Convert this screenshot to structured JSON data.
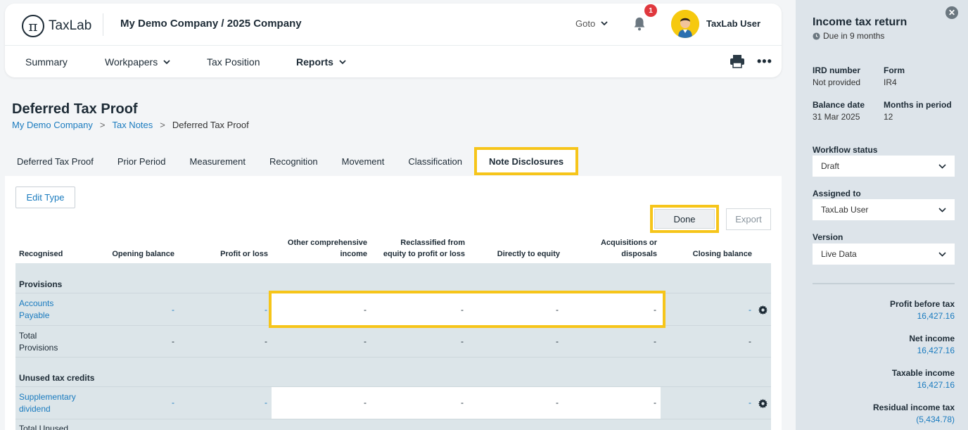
{
  "header": {
    "logo_symbol": "π",
    "logo_text": "TaxLab",
    "company": "My Demo Company / 2025 Company",
    "goto_label": "Goto",
    "notification_count": "1",
    "user_name": "TaxLab User"
  },
  "nav": {
    "summary": "Summary",
    "workpapers": "Workpapers",
    "tax_position": "Tax Position",
    "reports": "Reports"
  },
  "page": {
    "title": "Deferred Tax Proof",
    "breadcrumb": {
      "item1": "My Demo Company",
      "sep": ">",
      "item2": "Tax Notes",
      "item3": "Deferred Tax Proof"
    }
  },
  "tabs": [
    {
      "label": "Deferred Tax Proof"
    },
    {
      "label": "Prior Period"
    },
    {
      "label": "Measurement"
    },
    {
      "label": "Recognition"
    },
    {
      "label": "Movement"
    },
    {
      "label": "Classification"
    },
    {
      "label": "Note Disclosures"
    }
  ],
  "toolbar": {
    "edit_type": "Edit Type",
    "done": "Done",
    "export": "Export"
  },
  "table": {
    "headers": {
      "recognised": "Recognised",
      "opening": "Opening balance",
      "profit": "Profit or loss",
      "oci_1": "Other comprehensive",
      "oci_2": "income",
      "reclass_1": "Reclassified from",
      "reclass_2": "equity to profit or loss",
      "equity": "Directly to equity",
      "acq_1": "Acquisitions or",
      "acq_2": "disposals",
      "closing": "Closing balance"
    },
    "sections": {
      "provisions": "Provisions",
      "unused": "Unused tax credits"
    },
    "rows": {
      "ap_1": "Accounts",
      "ap_2": "Payable",
      "tp_1": "Total",
      "tp_2": "Provisions",
      "sd_1": "Supplementary",
      "sd_2": "dividend",
      "tu_1": "Total Unused"
    },
    "dash": "-"
  },
  "sidebar": {
    "title": "Income tax return",
    "due": "Due in 9 months",
    "ird_label": "IRD number",
    "ird_value": "Not provided",
    "form_label": "Form",
    "form_value": "IR4",
    "balance_label": "Balance date",
    "balance_value": "31 Mar 2025",
    "months_label": "Months in period",
    "months_value": "12",
    "workflow_label": "Workflow status",
    "workflow_value": "Draft",
    "assigned_label": "Assigned to",
    "assigned_value": "TaxLab User",
    "version_label": "Version",
    "version_value": "Live Data",
    "metrics": {
      "pbt_label": "Profit before tax",
      "pbt_value": "16,427.16",
      "ni_label": "Net income",
      "ni_value": "16,427.16",
      "ti_label": "Taxable income",
      "ti_value": "16,427.16",
      "rit_label": "Residual income tax",
      "rit_value": "(5,434.78)"
    }
  },
  "colors": {
    "accent_link": "#1a7bbf",
    "highlight": "#f6c51a",
    "table_bg": "#dce5e9",
    "badge": "#e0383e"
  }
}
